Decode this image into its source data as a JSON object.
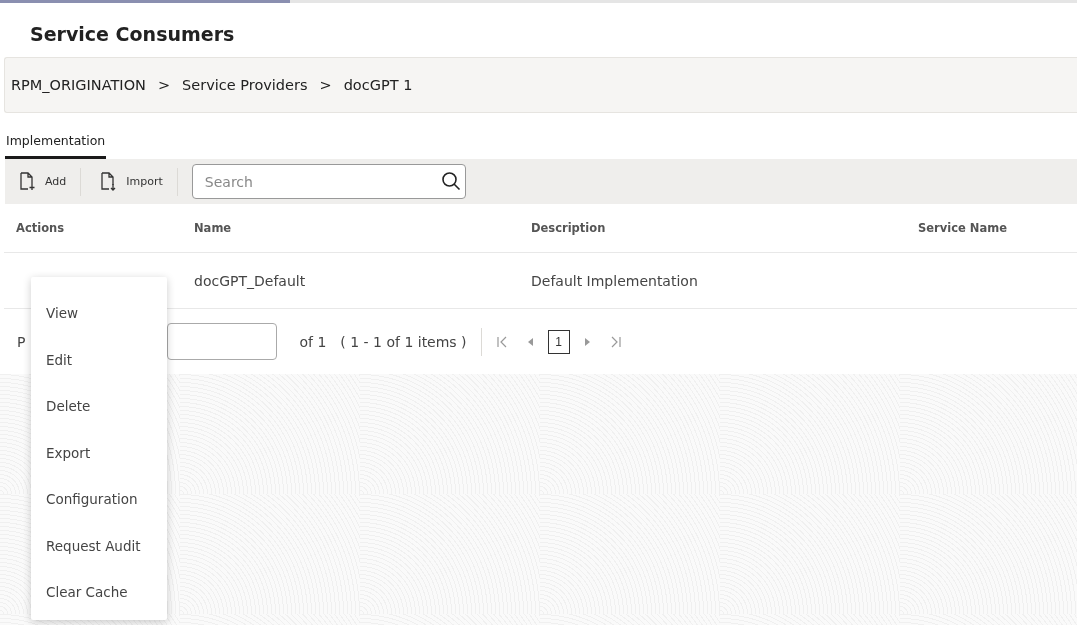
{
  "page_title": "Service Consumers",
  "breadcrumb": [
    {
      "label": "RPM_ORIGINATION",
      "separator": ">"
    },
    {
      "label": "Service Providers",
      "separator": ">"
    },
    {
      "label": "docGPT 1"
    }
  ],
  "tabs": [
    {
      "label": "Implementation",
      "selected": true
    }
  ],
  "toolbar": {
    "buttons": [
      {
        "label": "Add",
        "kind": "add"
      },
      {
        "label": "Import",
        "kind": "import"
      }
    ],
    "search": {
      "placeholder": "Search"
    }
  },
  "table": {
    "columns": [
      "Actions",
      "Name",
      "Description",
      "Service Name"
    ],
    "rows": [
      {
        "name": "docGPT_Default",
        "description": "Default Implementation"
      }
    ]
  },
  "pagination": {
    "label": "P",
    "of": "of 1",
    "range": "( 1 - 1 of 1 items )",
    "current_page": "1"
  },
  "action_menu": [
    {
      "label": "View"
    },
    {
      "label": "Edit"
    },
    {
      "label": "Delete"
    },
    {
      "label": "Export"
    },
    {
      "label": "Configuration"
    },
    {
      "label": "Request Audit"
    },
    {
      "label": "Clear Cache"
    }
  ]
}
